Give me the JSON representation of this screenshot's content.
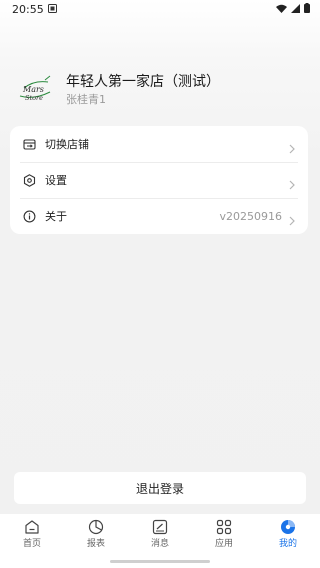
{
  "status_bar": {
    "time": "20:55"
  },
  "profile": {
    "logo_text_top": "Mars",
    "logo_text_bottom": "Store",
    "store_name": "年轻人第一家店（测试）",
    "user_name": "张桂青1"
  },
  "menu": {
    "items": [
      {
        "label": "切换店铺",
        "icon": "store-switch-icon",
        "value": ""
      },
      {
        "label": "设置",
        "icon": "settings-icon",
        "value": ""
      },
      {
        "label": "关于",
        "icon": "info-icon",
        "value": "v20250916"
      }
    ]
  },
  "logout_label": "退出登录",
  "tabs": [
    {
      "label": "首页",
      "icon": "home-icon",
      "active": false
    },
    {
      "label": "报表",
      "icon": "report-pie-icon",
      "active": false
    },
    {
      "label": "消息",
      "icon": "message-icon",
      "active": false
    },
    {
      "label": "应用",
      "icon": "apps-grid-icon",
      "active": false
    },
    {
      "label": "我的",
      "icon": "profile-icon",
      "active": true
    }
  ],
  "colors": {
    "accent": "#1a73e8",
    "text_primary": "#1a1a1a",
    "text_secondary": "#9a9a9a",
    "background": "#f1f1f1",
    "card": "#ffffff"
  }
}
